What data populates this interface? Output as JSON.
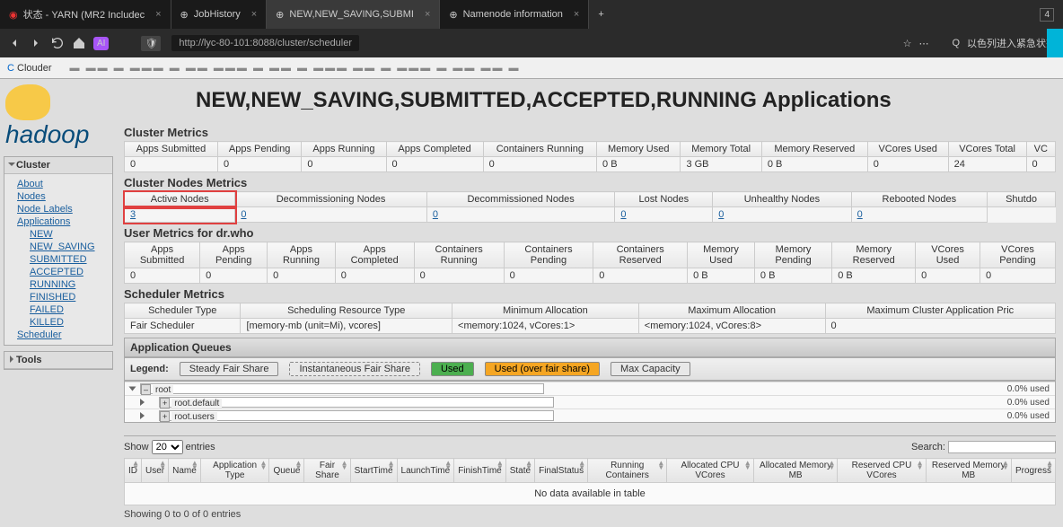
{
  "browser": {
    "tabs": [
      {
        "title": "状态 - YARN (MR2 Includec"
      },
      {
        "title": "JobHistory"
      },
      {
        "title": "NEW,NEW_SAVING,SUBMI"
      },
      {
        "title": "Namenode information"
      }
    ],
    "url": "http://lyc-80-101:8088/cluster/scheduler",
    "search_placeholder": "以色列进入紧急状态",
    "bookmark": "Clouder",
    "tab_count": "4"
  },
  "page": {
    "title": "NEW,NEW_SAVING,SUBMITTED,ACCEPTED,RUNNING Applications",
    "logo": "hadoop"
  },
  "nav": {
    "cluster": "Cluster",
    "about": "About",
    "nodes": "Nodes",
    "node_labels": "Node Labels",
    "applications": "Applications",
    "app_states": [
      "NEW",
      "NEW_SAVING",
      "SUBMITTED",
      "ACCEPTED",
      "RUNNING",
      "FINISHED",
      "FAILED",
      "KILLED"
    ],
    "scheduler": "Scheduler",
    "tools": "Tools"
  },
  "cluster_metrics": {
    "title": "Cluster Metrics",
    "headers": [
      "Apps Submitted",
      "Apps Pending",
      "Apps Running",
      "Apps Completed",
      "Containers Running",
      "Memory Used",
      "Memory Total",
      "Memory Reserved",
      "VCores Used",
      "VCores Total",
      "VC"
    ],
    "values": [
      "0",
      "0",
      "0",
      "0",
      "0",
      "0 B",
      "3 GB",
      "0 B",
      "0",
      "24",
      "0"
    ]
  },
  "nodes_metrics": {
    "title": "Cluster Nodes Metrics",
    "headers": [
      "Active Nodes",
      "Decommissioning Nodes",
      "Decommissioned Nodes",
      "Lost Nodes",
      "Unhealthy Nodes",
      "Rebooted Nodes",
      "Shutdo"
    ],
    "values": [
      "3",
      "0",
      "0",
      "0",
      "0",
      "0"
    ]
  },
  "user_metrics": {
    "title": "User Metrics for dr.who",
    "headers": [
      "Apps Submitted",
      "Apps Pending",
      "Apps Running",
      "Apps Completed",
      "Containers Running",
      "Containers Pending",
      "Containers Reserved",
      "Memory Used",
      "Memory Pending",
      "Memory Reserved",
      "VCores Used",
      "VCores Pending"
    ],
    "values": [
      "0",
      "0",
      "0",
      "0",
      "0",
      "0",
      "0",
      "0 B",
      "0 B",
      "0 B",
      "0",
      "0"
    ]
  },
  "scheduler_metrics": {
    "title": "Scheduler Metrics",
    "headers": [
      "Scheduler Type",
      "Scheduling Resource Type",
      "Minimum Allocation",
      "Maximum Allocation",
      "Maximum Cluster Application Pric"
    ],
    "values": [
      "Fair Scheduler",
      "[memory-mb (unit=Mi), vcores]",
      "<memory:1024, vCores:1>",
      "<memory:1024, vCores:8>",
      "0"
    ]
  },
  "queues": {
    "title": "Application Queues",
    "legend_label": "Legend:",
    "legend": [
      "Steady Fair Share",
      "Instantaneous Fair Share",
      "Used",
      "Used (over fair share)",
      "Max Capacity"
    ],
    "items": [
      {
        "name": "root",
        "used": "0.0% used"
      },
      {
        "name": "root.default",
        "used": "0.0% used"
      },
      {
        "name": "root.users",
        "used": "0.0% used"
      }
    ]
  },
  "apps": {
    "show": "Show",
    "page_size": "20",
    "entries": "entries",
    "search": "Search:",
    "headers": [
      "ID",
      "User",
      "Name",
      "Application Type",
      "Queue",
      "Fair Share",
      "StartTime",
      "LaunchTime",
      "FinishTime",
      "State",
      "FinalStatus",
      "Running Containers",
      "Allocated CPU VCores",
      "Allocated Memory MB",
      "Reserved CPU VCores",
      "Reserved Memory MB",
      "Progress"
    ],
    "no_data": "No data available in table",
    "info": "Showing 0 to 0 of 0 entries"
  }
}
